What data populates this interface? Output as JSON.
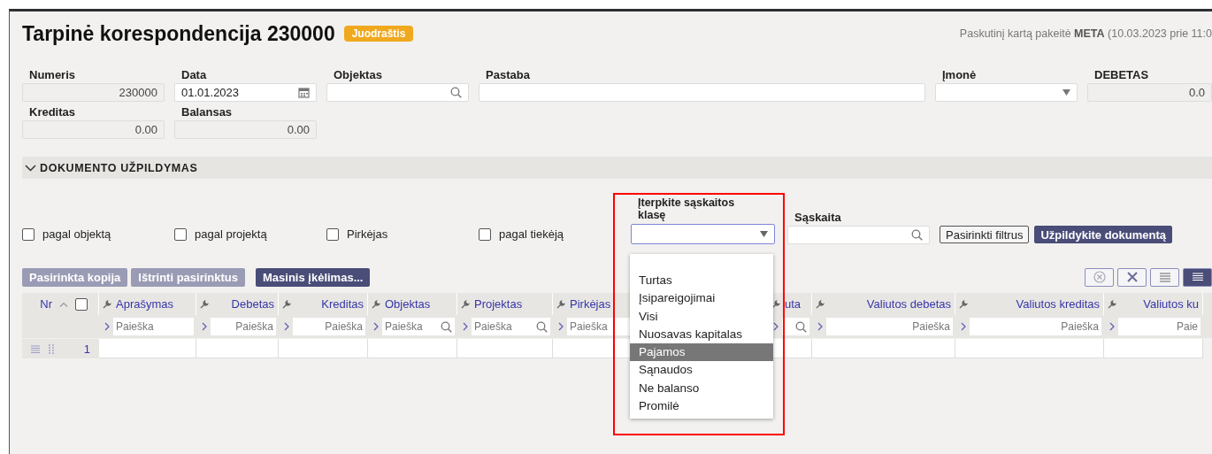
{
  "header": {
    "title": "Tarpinė korespondencija 230000",
    "status_badge": "Juodraštis",
    "last_modified": "Paskutinį kartą pakeitė **META** (10.03.2023 prie 11:0"
  },
  "fields": [
    {
      "label": "Numeris",
      "value": "230000",
      "kind": "readonly"
    },
    {
      "label": "Data",
      "value": "01.01.2023",
      "kind": "date"
    },
    {
      "label": "Objektas",
      "kind": "search"
    },
    {
      "label": "Pastaba",
      "kind": "text"
    },
    {
      "label": "Įmonė",
      "kind": "select"
    },
    {
      "label": "DEBETAS",
      "value": "0.0",
      "kind": "readonly"
    },
    {
      "label": "Kreditas",
      "value": "0.00",
      "kind": "readonly"
    },
    {
      "label": "Balansas",
      "value": "0.00",
      "kind": "readonly"
    }
  ],
  "section": {
    "title": "DOKUMENTO UŽPILDYMAS",
    "expanded": true
  },
  "filters": [
    {
      "label": "pagal objektą",
      "checked": false
    },
    {
      "label": "pagal projektą",
      "checked": false
    },
    {
      "label": "Pirkėjas",
      "checked": false
    },
    {
      "label": "pagal tiekėją",
      "checked": false
    }
  ],
  "account_class": {
    "label": "Įterpkite sąskaitos klasę",
    "open": true,
    "options": [
      {
        "label": "Turtas",
        "selected": false
      },
      {
        "label": "Įsipareigojimai",
        "selected": false
      },
      {
        "label": "Visi",
        "selected": false
      },
      {
        "label": "Nuosavas kapitalas",
        "selected": false
      },
      {
        "label": "Pajamos",
        "selected": true
      },
      {
        "label": "Sąnaudos",
        "selected": false
      },
      {
        "label": "Ne balanso",
        "selected": false
      },
      {
        "label": "Promilė",
        "selected": false
      }
    ]
  },
  "account": {
    "label": "Sąskaita"
  },
  "filter_buttons": [
    {
      "label": "Pasirinkti filtrus",
      "kind": "outline"
    },
    {
      "label": "Užpildykite dokumentą",
      "kind": "primary"
    }
  ],
  "row_actions": [
    {
      "label": "Pasirinkta kopija",
      "disabled": true
    },
    {
      "label": "Ištrinti pasirinktus",
      "disabled": true
    },
    {
      "label": "Masinis įkėlimas...",
      "disabled": false
    }
  ],
  "view_buttons": [
    {
      "kind": "clear"
    },
    {
      "kind": "excel"
    },
    {
      "kind": "list",
      "selected": false
    },
    {
      "kind": "compact",
      "selected": true
    }
  ],
  "table": {
    "columns": [
      {
        "label": "Nr",
        "kind": "index"
      },
      {
        "label": "Aprašymas",
        "kind": "text",
        "placeholder": "Paieška"
      },
      {
        "label": "Debetas",
        "kind": "number",
        "placeholder": "Paieška"
      },
      {
        "label": "Kreditas",
        "kind": "number",
        "placeholder": "Paieška"
      },
      {
        "label": "Objektas",
        "kind": "lookup",
        "placeholder": "Paieška"
      },
      {
        "label": "Projektas",
        "kind": "lookup",
        "placeholder": "Paieška"
      },
      {
        "label": "Pirkėjas",
        "kind": "text",
        "placeholder": "Paieška"
      },
      {
        "label": "uta",
        "kind": "lookup"
      },
      {
        "label": "Valiutos debetas",
        "kind": "number",
        "placeholder": "Paieška"
      },
      {
        "label": "Valiutos kreditas",
        "kind": "number",
        "placeholder": "Paieška"
      },
      {
        "label": "Valiutos ku",
        "kind": "number",
        "placeholder": "Paie"
      }
    ],
    "select_all_checked": false,
    "rows": [
      {
        "nr": "1"
      }
    ]
  }
}
